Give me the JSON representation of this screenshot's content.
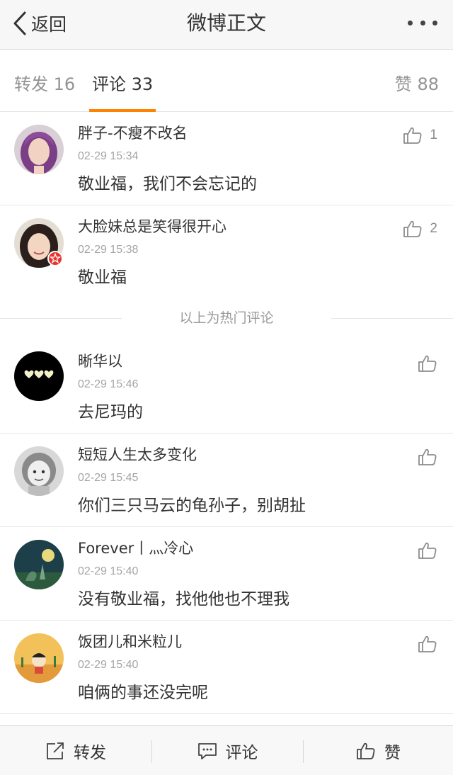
{
  "navbar": {
    "back_label": "返回",
    "title": "微博正文"
  },
  "tabs": {
    "repost": "转发 16",
    "comment": "评论 33",
    "like": "赞 88"
  },
  "hot_divider": "以上为热门评论",
  "comments": [
    {
      "user": "胖子-不瘦不改名",
      "time": "02-29 15:34",
      "text": "敬业福，我们不会忘记的",
      "likes": "1"
    },
    {
      "user": "大脸妹总是笑得很开心",
      "time": "02-29 15:38",
      "text": "敬业福",
      "likes": "2"
    },
    {
      "user": "晰华以",
      "time": "02-29 15:46",
      "text": "去尼玛的"
    },
    {
      "user": "短短人生太多变化",
      "time": "02-29 15:45",
      "text": "你们三只马云的龟孙子，别胡扯"
    },
    {
      "user": "Forever丨灬冷心",
      "time": "02-29 15:40",
      "text": "没有敬业福，找他他也不理我"
    },
    {
      "user": "饭团儿和米粒儿",
      "time": "02-29 15:40",
      "text": "咱俩的事还没完呢"
    }
  ],
  "toolbar": {
    "repost": "转发",
    "comment": "评论",
    "like": "赞"
  },
  "colors": {
    "accent": "#ff8200",
    "navbar_bg": "#f7f7f7",
    "muted_text": "#a5a5a5",
    "badge": "#e8342b"
  },
  "icons": {
    "back": "chevron-left-icon",
    "more": "more-dots-icon",
    "like": "thumbs-up-icon",
    "repost": "share-out-icon",
    "comment": "speech-bubble-icon",
    "verified": "verified-star-icon"
  }
}
